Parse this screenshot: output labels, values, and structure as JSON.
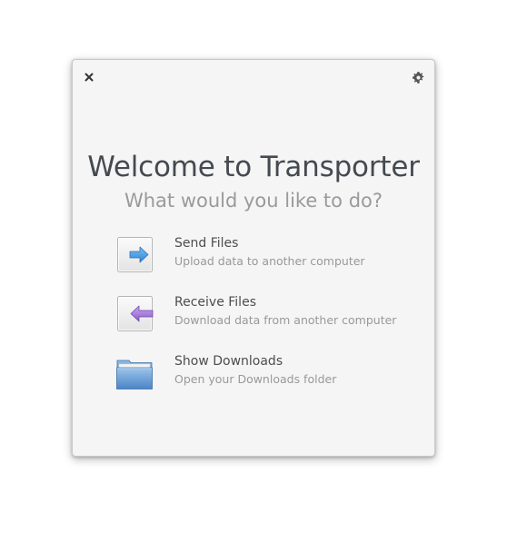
{
  "window": {
    "title": "Welcome to Transporter",
    "subtitle": "What would you like to do?"
  },
  "header": {
    "close_icon": "close-icon",
    "settings_icon": "gear-icon"
  },
  "actions": [
    {
      "label": "Send Files",
      "description": "Upload data to another computer",
      "icon": "send-arrow-icon",
      "accent": "#3d8fd6"
    },
    {
      "label": "Receive Files",
      "description": "Download data from another computer",
      "icon": "receive-arrow-icon",
      "accent": "#9b6fd1"
    },
    {
      "label": "Show Downloads",
      "description": "Open your Downloads folder",
      "icon": "folder-icon",
      "accent": "#5e9ad6"
    }
  ]
}
